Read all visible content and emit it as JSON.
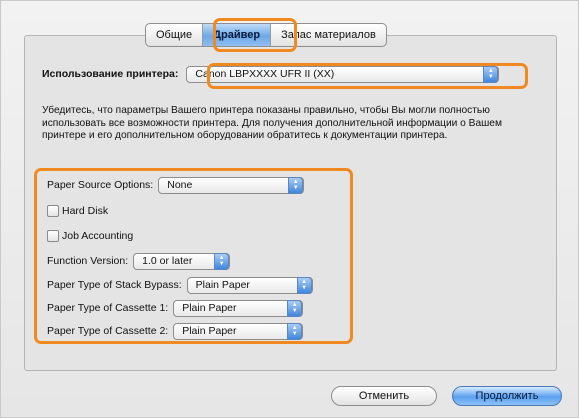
{
  "tabs": [
    {
      "label": "Общие",
      "active": false
    },
    {
      "label": "Драйвер",
      "active": true
    },
    {
      "label": "Запас материалов",
      "active": false
    }
  ],
  "printer": {
    "label": "Использование принтера:",
    "selected": "Canon LBPXXXX UFR II (XX)"
  },
  "info_text": "Убедитесь, что параметры Вашего принтера показаны правильно, чтобы Вы могли полностью использовать все возможности принтера. Для получения дополнительной информации о Вашем принтере и его дополнительном оборудовании обратитесь к документации принтера.",
  "options": {
    "paper_source": {
      "label": "Paper Source Options:",
      "value": "None"
    },
    "hard_disk": {
      "label": "Hard Disk",
      "checked": false
    },
    "job_accounting": {
      "label": "Job Accounting",
      "checked": false
    },
    "function_version": {
      "label": "Function Version:",
      "value": "1.0 or later"
    },
    "stack_bypass": {
      "label": "Paper Type of Stack Bypass:",
      "value": "Plain Paper"
    },
    "cassette1": {
      "label": "Paper Type of Cassette 1:",
      "value": "Plain Paper"
    },
    "cassette2": {
      "label": "Paper Type of Cassette 2:",
      "value": "Plain Paper"
    }
  },
  "buttons": {
    "cancel": "Отменить",
    "continue": "Продолжить"
  },
  "colors": {
    "highlight": "#f0891f",
    "accent": "#5aa0ee"
  },
  "icons": {
    "popup_arrows": "updown-arrows-icon"
  }
}
